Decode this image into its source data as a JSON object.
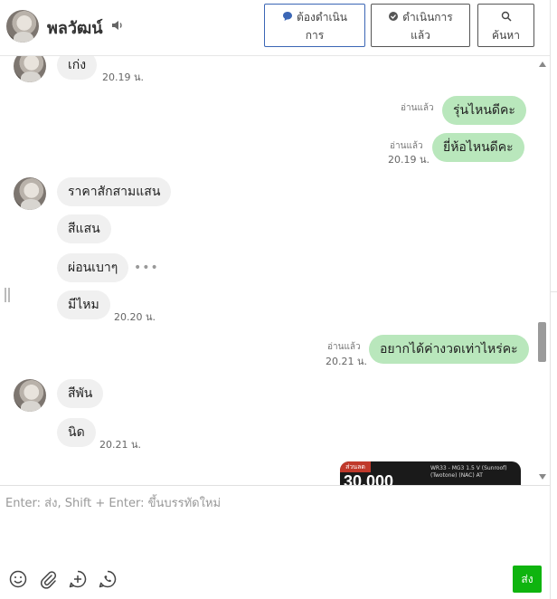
{
  "header": {
    "contact_name": "พลวัฒน์",
    "btn_pending_line1": "ต้องดำเนิน",
    "btn_pending_line2": "การ",
    "btn_done_line1": "ดำเนินการ",
    "btn_done_line2": "แล้ว",
    "btn_search": "ค้นหา"
  },
  "messages": [
    {
      "text": "เก่ง",
      "time": "20.19 น."
    },
    {
      "text": "รุ่นไหนดีคะ",
      "status": "อ่านแล้ว"
    },
    {
      "text": "ยี่ห้อไหนดีคะ",
      "status": "อ่านแล้ว",
      "time": "20.19 น."
    },
    {
      "text": "ราคาสักสามแสน"
    },
    {
      "text": "สีแสน"
    },
    {
      "text": "ผ่อนเบาๆ",
      "more": "•••"
    },
    {
      "text": "มีไหม",
      "time": "20.20 น."
    },
    {
      "text": "อยากได้ค่างวดเท่าไหร่คะ",
      "status": "อ่านแล้ว",
      "time": "20.21 น."
    },
    {
      "text": "สีพัน"
    },
    {
      "text": "นิด",
      "time": "20.21 น."
    }
  ],
  "image_preview": {
    "badge": "ส่วนลด",
    "big": "30,000",
    "caption": "WR33 - MG3 1.5 V (Sunroof) (Twotone) (NAC) AT"
  },
  "composer": {
    "placeholder": "Enter: ส่ง, Shift + Enter: ขึ้นบรรทัดใหม่",
    "send_label": "ส่ง"
  },
  "colors": {
    "outgoing_bubble": "#b9e7bc",
    "incoming_bubble": "#f0f0f0",
    "send_button": "#0fb40f",
    "primary_border": "#3b66b5"
  }
}
